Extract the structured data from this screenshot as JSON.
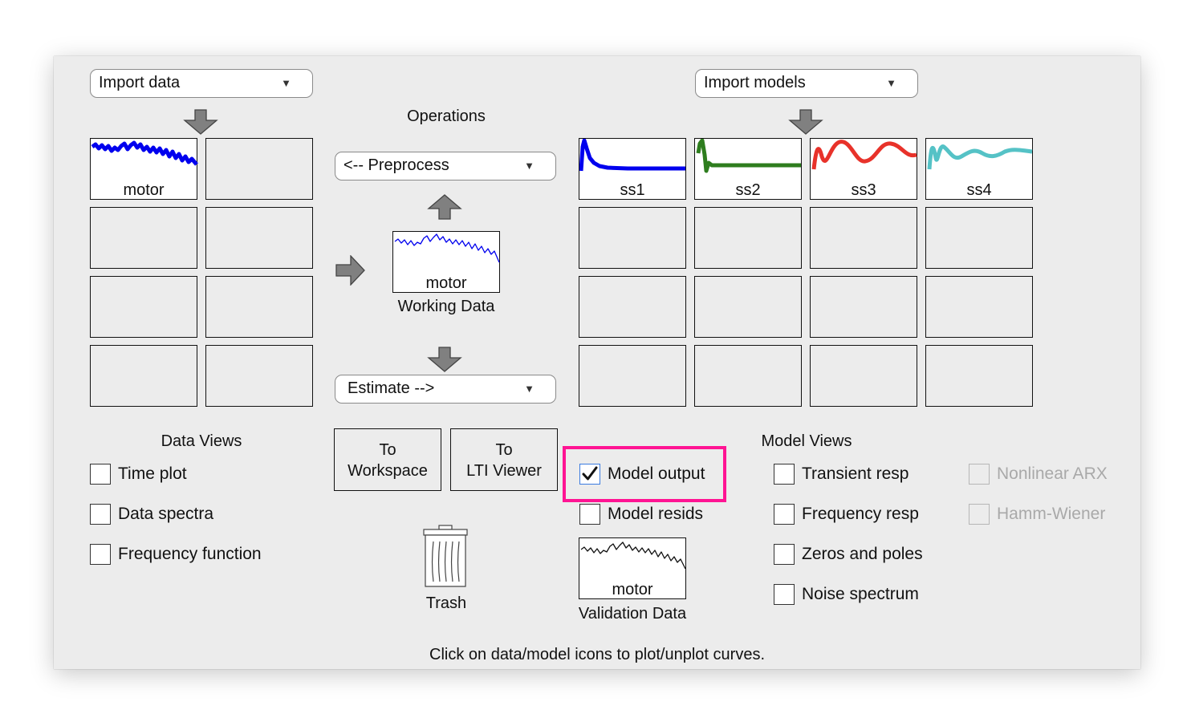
{
  "colors": {
    "motor_trace": "#0000ee",
    "ss1": "#0000ee",
    "ss2": "#2e7d1e",
    "ss3": "#e8322a",
    "ss4": "#55c2c6",
    "highlight": "#ff1493"
  },
  "import_data": {
    "label": "Import data",
    "icon": "chevron-down-icon"
  },
  "import_models": {
    "label": "Import models",
    "icon": "chevron-down-icon"
  },
  "operations": {
    "title": "Operations",
    "preprocess": "<-- Preprocess",
    "estimate": "Estimate -->"
  },
  "data_board": {
    "tiles": [
      {
        "label": "motor"
      }
    ]
  },
  "working_data": {
    "name": "motor",
    "caption": "Working Data"
  },
  "model_board": {
    "tiles": [
      {
        "label": "ss1"
      },
      {
        "label": "ss2"
      },
      {
        "label": "ss3"
      },
      {
        "label": "ss4"
      }
    ]
  },
  "data_views": {
    "title": "Data Views",
    "items": [
      {
        "label": "Time plot",
        "checked": false
      },
      {
        "label": "Data spectra",
        "checked": false
      },
      {
        "label": "Frequency function",
        "checked": false
      }
    ]
  },
  "buttons": {
    "to_workspace": {
      "line1": "To",
      "line2": "Workspace"
    },
    "to_lti": {
      "line1": "To",
      "line2": "LTI Viewer"
    }
  },
  "trash": {
    "label": "Trash",
    "icon": "trash-icon"
  },
  "model_output": {
    "label": "Model output",
    "checked": true
  },
  "model_resids": {
    "label": "Model resids",
    "checked": false
  },
  "validation_data": {
    "name": "motor",
    "caption": "Validation Data"
  },
  "model_views": {
    "title": "Model Views",
    "items": [
      {
        "label": "Transient resp",
        "checked": false
      },
      {
        "label": "Frequency resp",
        "checked": false
      },
      {
        "label": "Zeros and poles",
        "checked": false
      },
      {
        "label": "Noise spectrum",
        "checked": false
      }
    ],
    "disabled_items": [
      {
        "label": "Nonlinear ARX"
      },
      {
        "label": "Hamm-Wiener"
      }
    ]
  },
  "status": "Click on data/model icons to plot/unplot curves."
}
